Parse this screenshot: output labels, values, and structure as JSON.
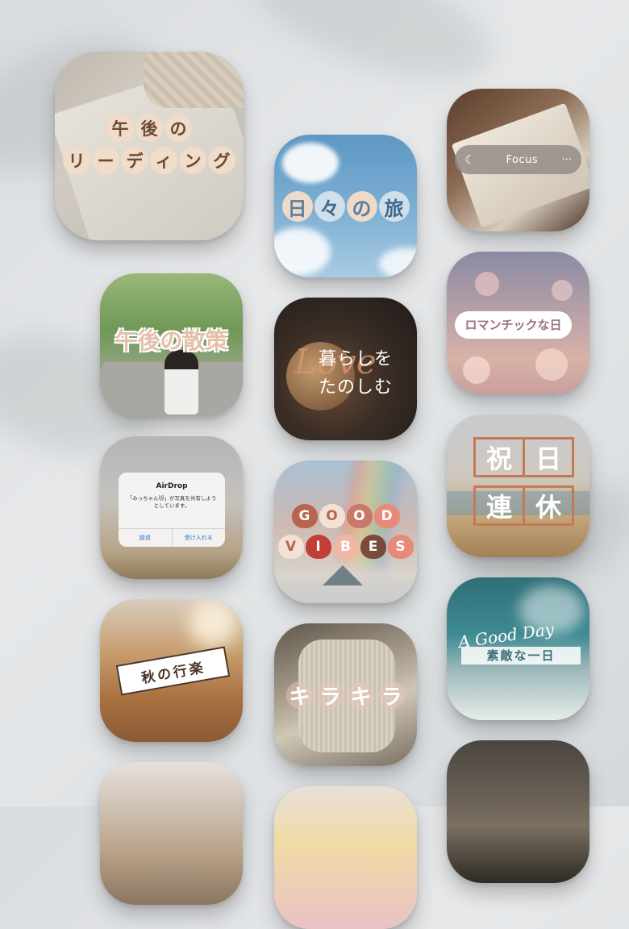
{
  "tiles": {
    "afternoon_reading": {
      "line1": [
        "午",
        "後",
        "の"
      ],
      "line2": [
        "リ",
        "ー",
        "デ",
        "ィ",
        "ン",
        "グ"
      ]
    },
    "daily_journey": {
      "chars": [
        "日",
        "々",
        "の",
        "旅"
      ]
    },
    "focus": {
      "label": "Focus",
      "more": "···",
      "moon": "☾"
    },
    "afternoon_walk": {
      "text": "午後の散策"
    },
    "enjoy_life": {
      "line1": "暮らしを",
      "line2": "たのしむ",
      "script": "Love"
    },
    "romantic_day": {
      "text": "ロマンチックな日"
    },
    "airdrop": {
      "title": "AirDrop",
      "message": "「みっちゃん🐱」が写真を共有しようとしています。",
      "decline": "辞退",
      "accept": "受け入れる"
    },
    "good_vibes": {
      "row1": [
        "G",
        "O",
        "O",
        "D"
      ],
      "row2": [
        "V",
        "I",
        "B",
        "E",
        "S"
      ]
    },
    "holiday": {
      "row1": [
        "祝",
        "日"
      ],
      "row2": [
        "連",
        "休"
      ]
    },
    "autumn_trip": {
      "text": "秋の行楽"
    },
    "kirakira": {
      "chars": [
        "キ",
        "ラ",
        "キ",
        "ラ"
      ]
    },
    "good_day": {
      "script": "A Good Day",
      "jp": "素敵な一日"
    }
  },
  "colors": {
    "bubble_bg": "#f0dcc8",
    "accent_brown": "#c47a55",
    "blue_sky": "#6fa6cc"
  }
}
